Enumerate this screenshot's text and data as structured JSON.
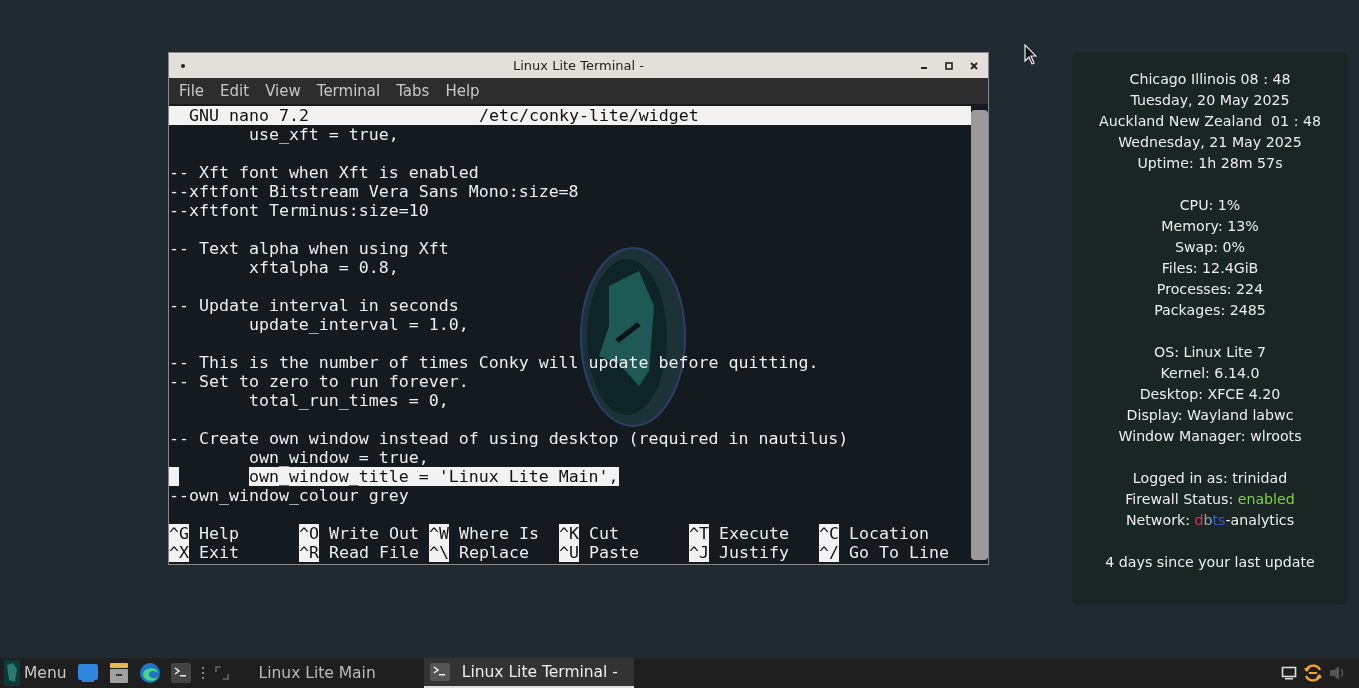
{
  "terminal_window": {
    "title": "Linux Lite Terminal -",
    "menu": [
      "File",
      "Edit",
      "View",
      "Terminal",
      "Tabs",
      "Help"
    ],
    "nano_header": {
      "version": "GNU nano 7.2",
      "path": "/etc/conky-lite/widget"
    },
    "lines": [
      {
        "kind": "text",
        "text": "        use_xft = true,",
        "selected": false
      },
      {
        "kind": "blank",
        "selected": false
      },
      {
        "kind": "text",
        "text": "-- Xft font when Xft is enabled",
        "selected": false
      },
      {
        "kind": "text",
        "text": "--xftfont Bitstream Vera Sans Mono:size=8",
        "selected": false
      },
      {
        "kind": "text",
        "text": "--xftfont Terminus:size=10",
        "selected": false
      },
      {
        "kind": "blank",
        "selected": false
      },
      {
        "kind": "text",
        "text": "-- Text alpha when using Xft",
        "selected": false
      },
      {
        "kind": "text",
        "text": "        xftalpha = 0.8,",
        "selected": false
      },
      {
        "kind": "blank",
        "selected": false
      },
      {
        "kind": "text",
        "text": "-- Update interval in seconds",
        "selected": false
      },
      {
        "kind": "text",
        "text": "        update_interval = 1.0,",
        "selected": false
      },
      {
        "kind": "blank",
        "selected": false
      },
      {
        "kind": "text",
        "text": "-- This is the number of times Conky will update before quitting.",
        "selected": false
      },
      {
        "kind": "text",
        "text": "-- Set to zero to run forever.",
        "selected": false
      },
      {
        "kind": "text",
        "text": "        total_run_times = 0,",
        "selected": false
      },
      {
        "kind": "blank",
        "selected": false
      },
      {
        "kind": "text",
        "text": "-- Create own window instead of using desktop (required in nautilus)",
        "selected": false
      },
      {
        "kind": "text",
        "text": "        own_window = true,",
        "selected": false
      },
      {
        "kind": "text",
        "text": "        own_window_title = 'Linux Lite Main',",
        "selected": true
      },
      {
        "kind": "text",
        "text": "--own_window_colour grey",
        "selected": false
      },
      {
        "kind": "blank",
        "selected": false
      }
    ],
    "shortcuts": [
      [
        {
          "key": "^G",
          "label": "Help"
        },
        {
          "key": "^O",
          "label": "Write Out"
        },
        {
          "key": "^W",
          "label": "Where Is"
        },
        {
          "key": "^K",
          "label": "Cut"
        },
        {
          "key": "^T",
          "label": "Execute"
        },
        {
          "key": "^C",
          "label": "Location"
        }
      ],
      [
        {
          "key": "^X",
          "label": "Exit"
        },
        {
          "key": "^R",
          "label": "Read File"
        },
        {
          "key": "^\\",
          "label": "Replace"
        },
        {
          "key": "^U",
          "label": "Paste"
        },
        {
          "key": "^J",
          "label": "Justify"
        },
        {
          "key": "^/",
          "label": "Go To Line"
        }
      ]
    ]
  },
  "conky": {
    "groups": [
      [
        [
          {
            "text": "Chicago Illinois 08 : 48"
          }
        ],
        [
          {
            "text": "Tuesday, 20 May 2025"
          }
        ],
        [
          {
            "text": "Auckland New Zealand  01 : 48"
          }
        ],
        [
          {
            "text": "Wednesday, 21 May 2025"
          }
        ],
        [
          {
            "text": "Uptime: 1h 28m 57s"
          }
        ]
      ],
      [
        [
          {
            "text": "CPU: 1%"
          }
        ],
        [
          {
            "text": "Memory: 13%"
          }
        ],
        [
          {
            "text": "Swap: 0%"
          }
        ],
        [
          {
            "text": "Files: 12.4GiB"
          }
        ],
        [
          {
            "text": "Processes: 224"
          }
        ],
        [
          {
            "text": "Packages: 2485"
          }
        ]
      ],
      [
        [
          {
            "text": "OS: Linux Lite 7"
          }
        ],
        [
          {
            "text": "Kernel: 6.14.0"
          }
        ],
        [
          {
            "text": "Desktop: XFCE 4.20"
          }
        ],
        [
          {
            "text": "Display: Wayland labwc"
          }
        ],
        [
          {
            "text": "Window Manager: wlroots"
          }
        ]
      ],
      [
        [
          {
            "text": "Logged in as: trinidad"
          }
        ],
        [
          {
            "text": "Firewall Status: "
          },
          {
            "text": "enabled",
            "color": "#7ed23f"
          }
        ],
        [
          {
            "text": "Network: "
          },
          {
            "text": "d",
            "color": "#e0305a"
          },
          {
            "text": "b",
            "color": "#9aa0b8"
          },
          {
            "text": "ts",
            "color": "#3a5ad8"
          },
          {
            "text": "-analytics"
          }
        ]
      ],
      [
        [
          {
            "text": "4 days since your last update"
          }
        ]
      ]
    ]
  },
  "taskbar": {
    "menu_label": "Menu",
    "tasks": [
      {
        "label": "Linux Lite Main",
        "selected": false
      },
      {
        "label": "Linux Lite Terminal -",
        "selected": true
      }
    ]
  }
}
